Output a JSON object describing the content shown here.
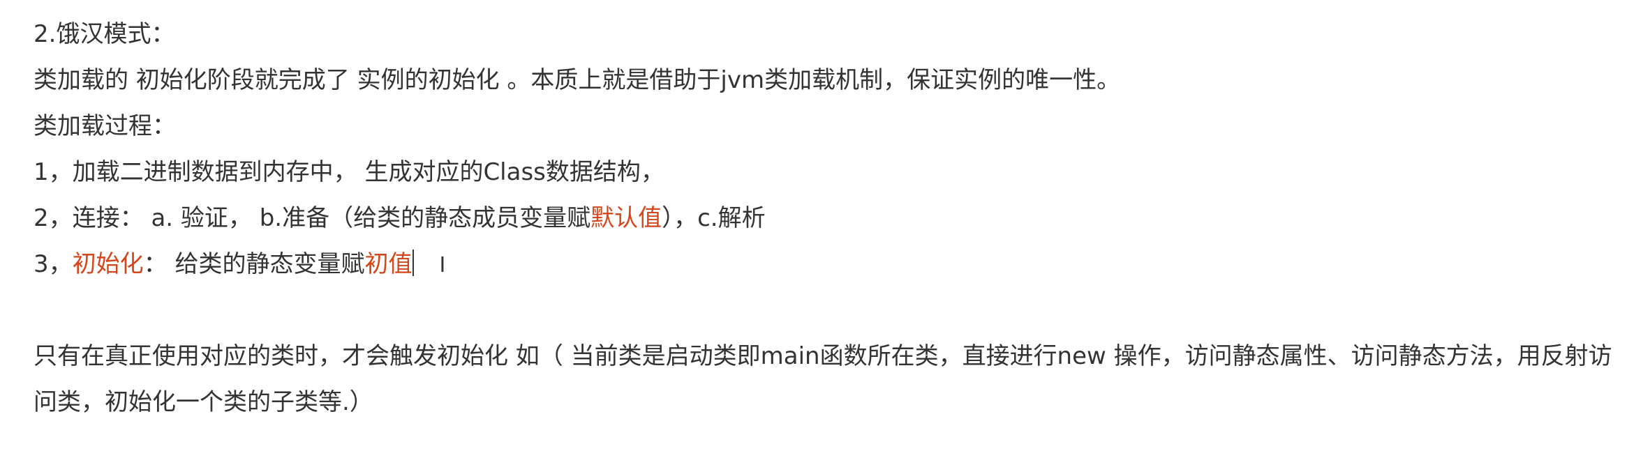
{
  "doc": {
    "line1": "2.饿汉模式：",
    "line2": "类加载的 初始化阶段就完成了 实例的初始化 。本质上就是借助于jvm类加载机制，保证实例的唯一性。",
    "line3": "类加载过程：",
    "line4": "1，加载二进制数据到内存中， 生成对应的Class数据结构，",
    "line5": {
      "part1": "2，连接： a. 验证， b.准备（给类的静态成员变量赋",
      "highlight": "默认值",
      "part2": "），c.解析"
    },
    "line6": {
      "prefix": "3，",
      "highlight1": "初始化",
      "middle": "： 给类的静态变量赋",
      "highlight2": "初值"
    },
    "para": "只有在真正使用对应的类时，才会触发初始化 如（ 当前类是启动类即main函数所在类，直接进行new 操作，访问静态属性、访问静态方法，用反射访问类，初始化一个类的子类等.）"
  },
  "colors": {
    "text": "#333333",
    "highlight": "#d4461c"
  }
}
